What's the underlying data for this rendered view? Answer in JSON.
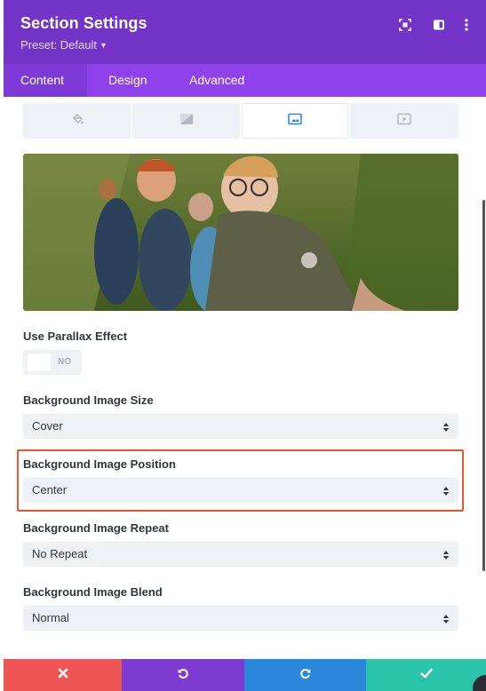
{
  "header": {
    "title": "Section Settings",
    "preset_label": "Preset: Default",
    "icons": [
      "screen-toggle-icon",
      "split-view-icon",
      "more-options-icon"
    ]
  },
  "tabs": [
    {
      "label": "Content",
      "active": true
    },
    {
      "label": "Design",
      "active": false
    },
    {
      "label": "Advanced",
      "active": false
    }
  ],
  "background_types": [
    {
      "icon": "paint-bucket-icon",
      "active": false
    },
    {
      "icon": "gradient-icon",
      "active": false
    },
    {
      "icon": "image-icon",
      "active": true
    },
    {
      "icon": "video-icon",
      "active": false
    }
  ],
  "fields": {
    "parallax": {
      "label": "Use Parallax Effect",
      "value": "NO"
    },
    "size": {
      "label": "Background Image Size",
      "value": "Cover"
    },
    "position": {
      "label": "Background Image Position",
      "value": "Center"
    },
    "repeat": {
      "label": "Background Image Repeat",
      "value": "No Repeat"
    },
    "blend": {
      "label": "Background Image Blend",
      "value": "Normal"
    }
  },
  "colors": {
    "header": "#7534c8",
    "tabs": "#8f42ec",
    "discard": "#ef5555",
    "undo": "#7e3bd0",
    "redo": "#2b87da",
    "save": "#29c4a9",
    "highlight": "#e8572f"
  },
  "footer": [
    {
      "icon": "discard-x-icon"
    },
    {
      "icon": "undo-icon"
    },
    {
      "icon": "redo-icon"
    },
    {
      "icon": "save-check-icon"
    }
  ]
}
